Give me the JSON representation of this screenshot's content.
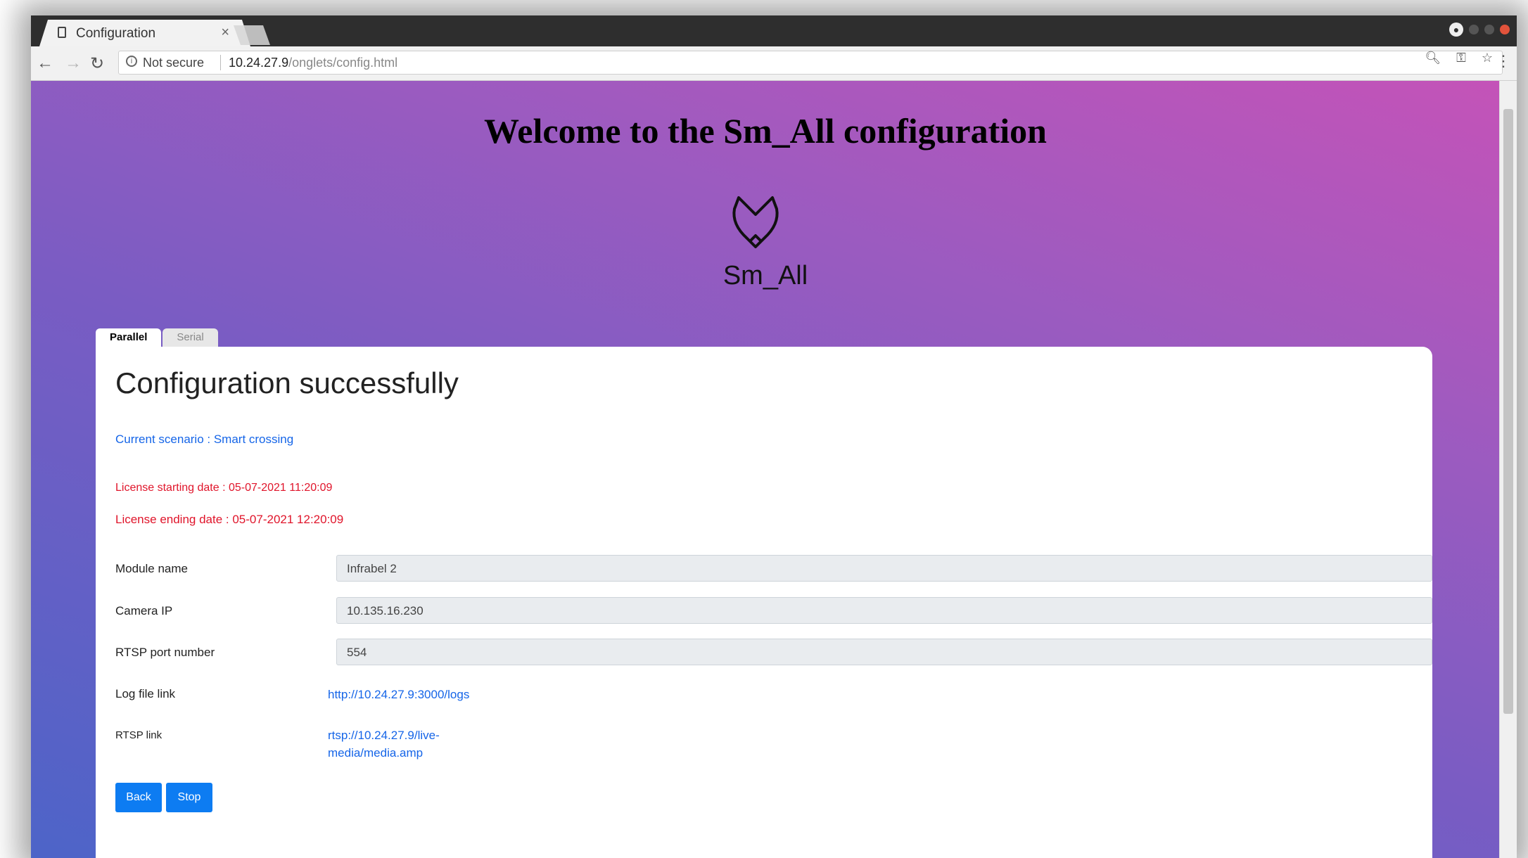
{
  "browser": {
    "tab_title": "Configuration",
    "tab_close": "×",
    "not_secure": "Not secure",
    "url_host": "10.24.27.9",
    "url_path": "/onglets/config.html"
  },
  "page": {
    "heading": "Welcome to the Sm_All configuration",
    "logo_text": "Sm_All",
    "tabs": [
      "Parallel",
      "Serial"
    ],
    "title": "Configuration successfully",
    "scenario": "Current scenario : Smart crossing",
    "license_start": "License starting date : 05-07-2021 11:20:09",
    "license_end": "License ending date : 05-07-2021 12:20:09",
    "fields": [
      {
        "label": "Module name",
        "value": "Infrabel 2"
      },
      {
        "label": "Camera IP",
        "value": "10.135.16.230"
      },
      {
        "label": "RTSP port number",
        "value": "554"
      }
    ],
    "log_label": "Log file link",
    "log_link": "http://10.24.27.9:3000/logs",
    "rtsp_label": "RTSP link",
    "rtsp_link_1": "rtsp://10.24.27.9/live-",
    "rtsp_link_2": "media/media.amp",
    "back_label": "Back",
    "stop_label": "Stop"
  }
}
